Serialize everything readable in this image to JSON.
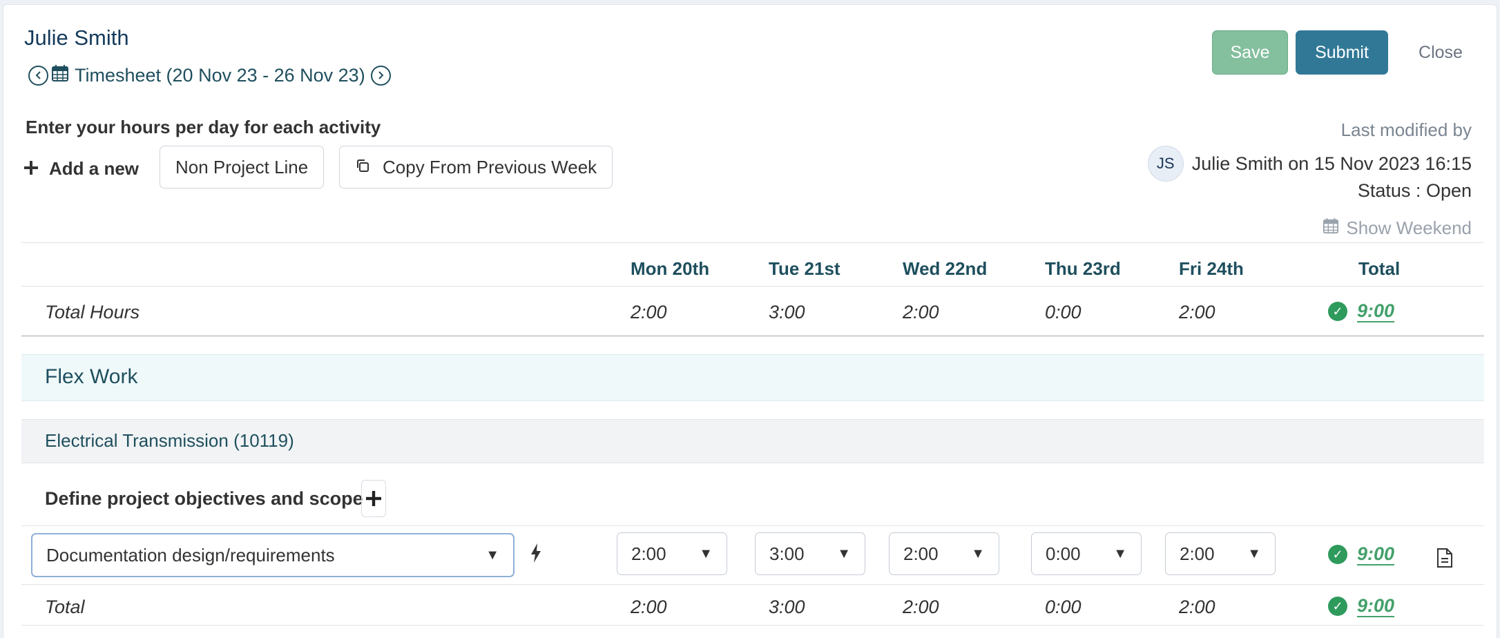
{
  "header": {
    "user_name": "Julie Smith",
    "timesheet_label": "Timesheet (20 Nov 23 - 26 Nov 23)",
    "save_label": "Save",
    "submit_label": "Submit",
    "close_label": "Close"
  },
  "toolbar": {
    "instruction": "Enter your hours per day for each activity",
    "add_new_label": "Add a new",
    "non_project_label": "Non Project Line",
    "copy_label": "Copy From Previous Week"
  },
  "meta": {
    "last_modified_label": "Last modified by",
    "avatar_initials": "JS",
    "modified_info": "Julie Smith on 15 Nov 2023 16:15",
    "status": "Status : Open",
    "show_weekend": "Show Weekend"
  },
  "colors": {
    "accent": "#317896",
    "success": "#43a06b",
    "save": "#84bf9e"
  },
  "grid": {
    "days": [
      "Mon 20th",
      "Tue 21st",
      "Wed 22nd",
      "Thu 23rd",
      "Fri 24th"
    ],
    "total_header": "Total",
    "total_hours_label": "Total Hours",
    "total_hours": [
      "2:00",
      "3:00",
      "2:00",
      "0:00",
      "2:00"
    ],
    "total_hours_sum": "9:00"
  },
  "section": {
    "name": "Flex Work",
    "project": "Electrical Transmission (10119)",
    "task": "Define project objectives and scope",
    "activity": "Documentation design/requirements",
    "hours": [
      "2:00",
      "3:00",
      "2:00",
      "0:00",
      "2:00"
    ],
    "hours_sum": "9:00",
    "total_label": "Total",
    "totals": [
      "2:00",
      "3:00",
      "2:00",
      "0:00",
      "2:00"
    ],
    "totals_sum": "9:00"
  }
}
